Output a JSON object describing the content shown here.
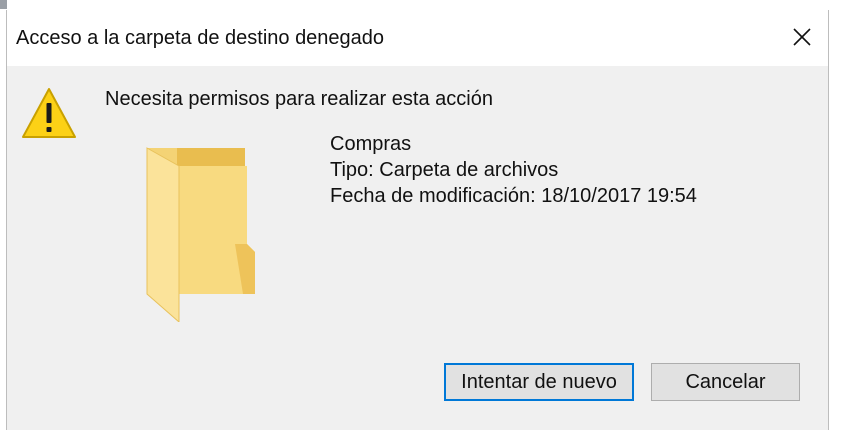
{
  "dialog": {
    "title": "Acceso a la carpeta de destino denegado",
    "close_icon": "close-icon",
    "message": "Necesita permisos para realizar esta acción",
    "warning_icon": "warning-icon",
    "folder_icon": "folder-icon",
    "item": {
      "name": "Compras",
      "type": "Tipo: Carpeta de archivos",
      "modified": "Fecha de modificación: 18/10/2017 19:54"
    },
    "buttons": {
      "retry_label": "Intentar de nuevo",
      "cancel_label": "Cancelar"
    }
  },
  "colors": {
    "dialog_background": "#f0f0f0",
    "title_background": "#ffffff",
    "focus_border": "#0078d7",
    "warning_fill": "#fcd116",
    "folder_fill": "#f8d775"
  }
}
